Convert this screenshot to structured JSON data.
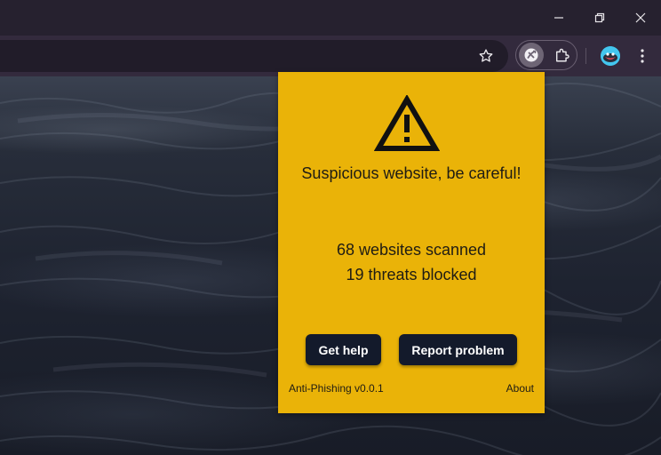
{
  "browser": {
    "window_controls": {
      "minimize_icon": "minimize-icon",
      "maximize_icon": "restore-icon",
      "close_icon": "close-icon"
    },
    "toolbar": {
      "bookmark_icon": "star-icon",
      "extensions": [
        "anti-phishing-icon",
        "puzzle-icon"
      ],
      "menu_icon": "kebab-menu-icon"
    }
  },
  "popup": {
    "background_color": "#eab308",
    "icon": "warning-triangle-icon",
    "headline": "Suspicious website, be careful!",
    "stats": {
      "scanned_text": "68 websites scanned",
      "blocked_text": "19 threats blocked"
    },
    "buttons": {
      "help_label": "Get help",
      "report_label": "Report problem"
    },
    "footer": {
      "version_text": "Anti-Phishing v0.0.1",
      "about_label": "About"
    }
  }
}
